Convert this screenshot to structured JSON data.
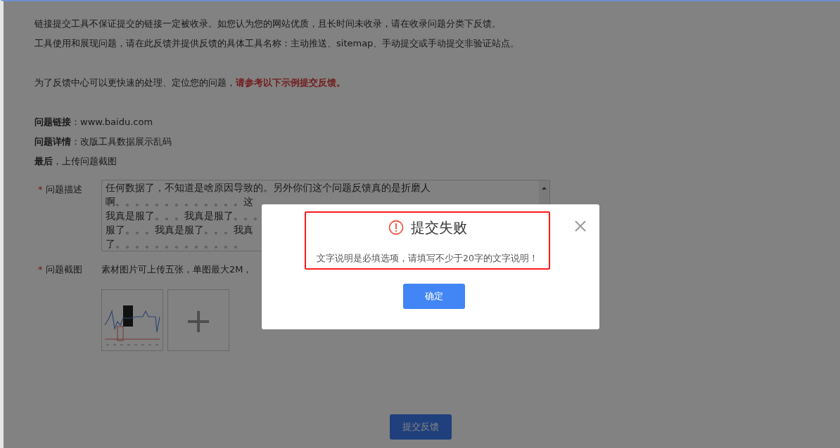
{
  "intro": [
    "链接提交工具不保证提交的链接一定被收录。如您认为您的网站优质，且长时间未收录，请在收录问题分类下反馈。",
    "工具使用和展现问题，请在此反馈并提供反馈的具体工具名称：主动推送、sitemap、手动提交或手动提交非验证站点。"
  ],
  "notice": "为了反馈中心可以更快速的处理、定位您的问题，**请参考以下示例提交反馈。**",
  "example": [
    "**问题链接**：www.baidu.com",
    "**问题详情**：改版工具数据展示乱码",
    "**最后**，上传问题截图"
  ],
  "fields": [
    {
      "kind": "textarea",
      "required_mark": "*",
      "label": "问题描述",
      "lines": [
        "任何数据了，不知道是啥原因导致的。另外你们这个问题反馈真的是折磨人",
        "啊。。。。。。。。。。。。。这",
        "我真是服了。。。我真是服了。。。",
        "服了。。。我真是服了。。。我真",
        "了。。。。。。。。。。。。。"
      ]
    },
    {
      "kind": "upload",
      "required_mark": "*",
      "label": "问题截图",
      "hint": "素材图片可上传五张，单图最大2M，",
      "thumbnails": [
        {
          "kind": "picture"
        },
        {
          "kind": "add",
          "symbol": "+"
        }
      ]
    }
  ],
  "submit_button": "提交反馈",
  "dialog": {
    "title": "提交失败",
    "message": "文字说明是必填选项，请填写不少于20字的文字说明！",
    "confirm": "确定",
    "highlighted": true
  }
}
